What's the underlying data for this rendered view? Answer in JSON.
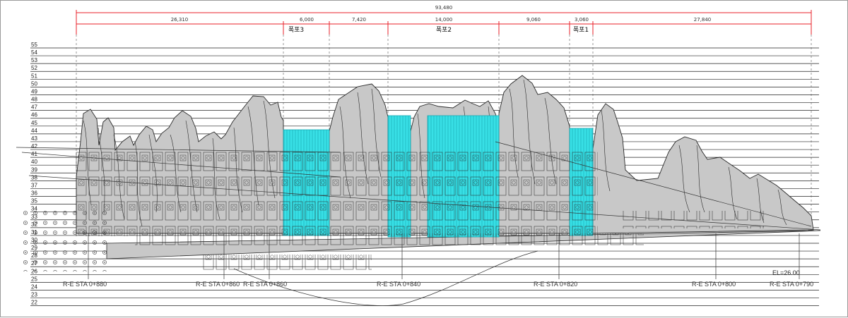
{
  "dimensions": {
    "total": "93,480",
    "segments": [
      "26,310",
      "6,000",
      "7,420",
      "14,000",
      "9,060",
      "3,060",
      "27,840"
    ]
  },
  "waterfalls": [
    {
      "label": "폭포3"
    },
    {
      "label": "폭포2"
    },
    {
      "label": "폭포1"
    }
  ],
  "elevation_labels": [
    "55",
    "54",
    "53",
    "52",
    "51",
    "50",
    "49",
    "48",
    "47",
    "46",
    "45",
    "44",
    "43",
    "42",
    "41",
    "40",
    "39",
    "38",
    "37",
    "36",
    "35",
    "34",
    "33",
    "32",
    "31",
    "30",
    "29",
    "28",
    "27",
    "26",
    "25",
    "24",
    "23",
    "22"
  ],
  "stations": [
    "R-E STA 0+880",
    "R-E STA 0+860",
    "R-E STA 0+860",
    "R-E STA 0+840",
    "R-E STA 0+820",
    "R-E STA 0+800",
    "R-E STA 0+790"
  ],
  "el_note": "EL=26.00",
  "colors": {
    "dimension": "#e8202a",
    "rock_fill": "#c8c8c8",
    "rock_stroke": "#2a2a2a",
    "water": "#38e0e6",
    "grid": "#222222",
    "guide": "#555555"
  }
}
